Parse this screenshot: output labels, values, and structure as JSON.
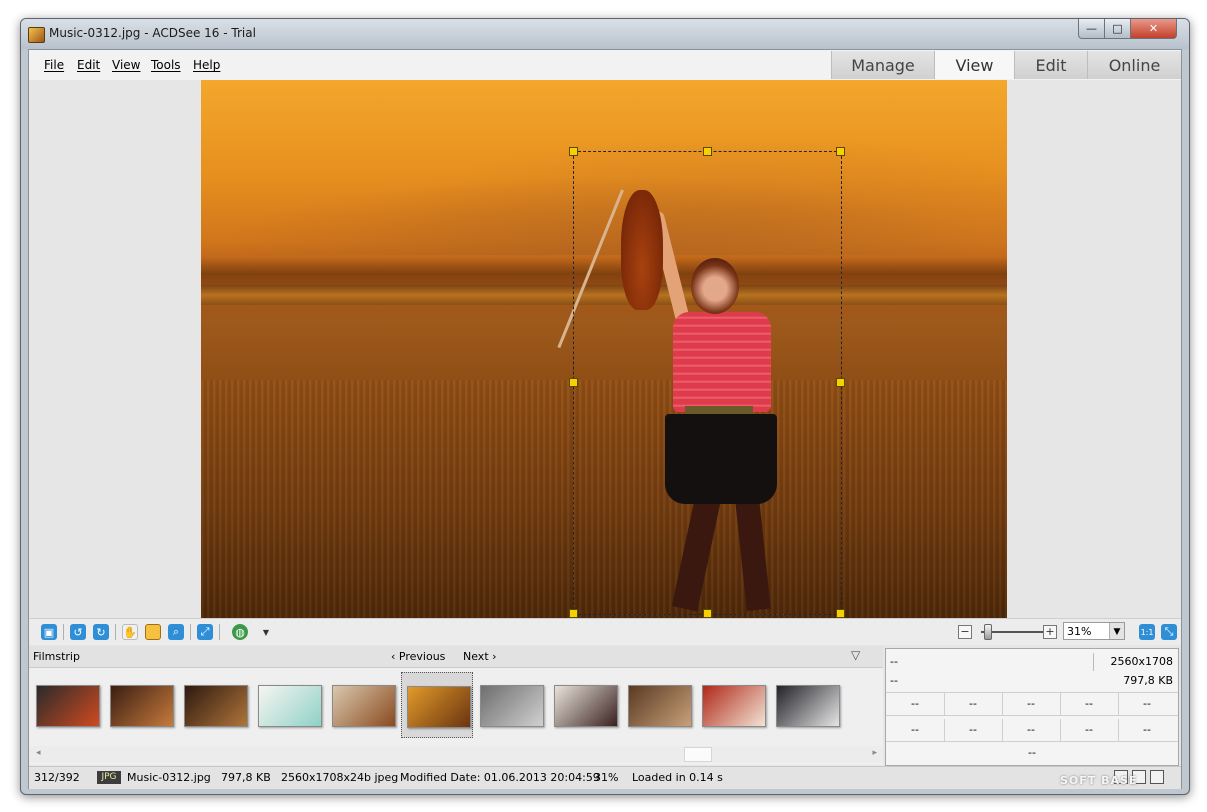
{
  "window": {
    "title": "Music-0312.jpg - ACDSee 16 - Trial",
    "minimize": "—",
    "maximize": "□",
    "close": "✕"
  },
  "menu": {
    "items": [
      "File",
      "Edit",
      "View",
      "Tools",
      "Help"
    ]
  },
  "modes": {
    "items": [
      "Manage",
      "View",
      "Edit",
      "Online"
    ],
    "active": "View"
  },
  "toolbar": {
    "zoom": "31%",
    "actual_size": "1:1",
    "zoom_minus": "−",
    "zoom_plus": "+"
  },
  "filmstrip": {
    "title": "Filmstrip",
    "previous": "Previous",
    "next": "Next",
    "collapse_icon": "▽",
    "thumbnails": [
      {
        "colors": [
          "#2a2a2a",
          "#d04a20"
        ]
      },
      {
        "colors": [
          "#3a1e12",
          "#c77a3c"
        ]
      },
      {
        "colors": [
          "#2d1a10",
          "#b0743a"
        ]
      },
      {
        "colors": [
          "#f6f6f0",
          "#8fd1c8"
        ]
      },
      {
        "colors": [
          "#d9c8ae",
          "#8a4a20"
        ]
      },
      {
        "colors": [
          "#e19a2a",
          "#6a3410"
        ]
      },
      {
        "colors": [
          "#6e6e6e",
          "#d0d0d0"
        ]
      },
      {
        "colors": [
          "#e8e4da",
          "#3a2020"
        ]
      },
      {
        "colors": [
          "#5a3a22",
          "#c8a07a"
        ]
      },
      {
        "colors": [
          "#b0281a",
          "#f2e4d4"
        ]
      },
      {
        "colors": [
          "#222228",
          "#e6e6e6"
        ]
      }
    ],
    "selected_index": 5
  },
  "info_panel": {
    "dims": "2560x1708",
    "size": "797,8 KB",
    "row1_left": "--",
    "row2_left": "--",
    "grid": [
      "--",
      "--",
      "--",
      "--",
      "--",
      "--",
      "--",
      "--",
      "--",
      "--"
    ],
    "bottom": "--"
  },
  "status": {
    "index": "312/392",
    "format_badge": "JPG",
    "filename": "Music-0312.jpg",
    "filesize": "797,8 KB",
    "image_info": "2560x1708x24b jpeg",
    "modified": "Modified Date: 01.06.2013 20:04:59",
    "zoom": "31%",
    "loaded": "Loaded in 0.14 s"
  },
  "watermark": "SOFT   BASE",
  "colors": {
    "accent": "#2f8fd6",
    "selection_handle": "#f6d000"
  }
}
